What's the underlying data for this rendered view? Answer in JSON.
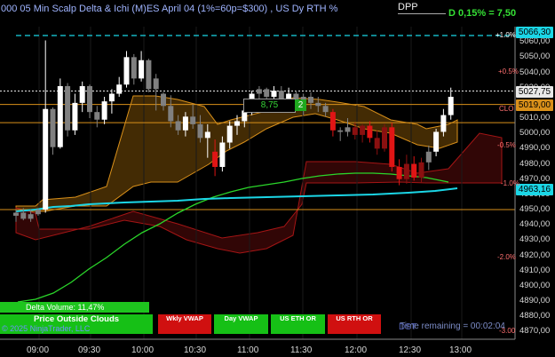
{
  "header": {
    "title": "000 05 Min Scalp Delta & Ichi (M)ES  April 04 (1%=60p=$300) , US Dy RTH %",
    "dpp_label": "DPP",
    "delta_readout": "D 0,15% = 7,50"
  },
  "price_axis": {
    "ticks": [
      "5060,00",
      "5050,00",
      "5040,00",
      "5030,00",
      "5010,00",
      "5000,00",
      "4990,00",
      "4980,00",
      "4970,00",
      "4960,00",
      "4950,00",
      "4940,00",
      "4930,00",
      "4920,00",
      "4910,00",
      "4900,00",
      "4890,00",
      "4880,00",
      "4870,00"
    ],
    "markers": [
      {
        "label": "5066,30",
        "color": "#1bd6e6",
        "text_color": "#000"
      },
      {
        "label": "5027,75",
        "color": "#e8e8e8",
        "text_color": "#000"
      },
      {
        "label": "5019,00",
        "color": "#d9901a",
        "text_color": "#000"
      },
      {
        "label": "4963,16",
        "color": "#1bd6e6",
        "text_color": "#000"
      }
    ]
  },
  "percent_labels": [
    "+1.0%",
    "+0.5%",
    "CLO",
    "-0.5%",
    "-1.0%",
    "-2.0%",
    "-3.00"
  ],
  "time_axis": {
    "ticks": [
      "09:00",
      "09:30",
      "10:00",
      "10:30",
      "11:00",
      "11:30",
      "12:00",
      "12:30",
      "13:00"
    ]
  },
  "price_marker": {
    "value": "8,75",
    "count": "2"
  },
  "delta_volume": {
    "label": "Delta Volume: 11,47%"
  },
  "status_buttons": [
    {
      "label": "Price Outside Clouds",
      "color": "#16c016"
    },
    {
      "label": "Wkly VWAP",
      "color": "#d01010"
    },
    {
      "label": "Day VWAP",
      "color": "#16c016"
    },
    {
      "label": "US ETH OR",
      "color": "#16c016"
    },
    {
      "label": "US RTH OR",
      "color": "#d01010"
    }
  ],
  "footer": {
    "copyright": "© 2025 NinjaTrader, LLC",
    "time_remaining": "Time remaining = 00:02:04",
    "dst": "DST"
  },
  "colors": {
    "background": "#000000",
    "bull_candle": "#ffffff",
    "bear_candle": "#d01010",
    "vwap": "#1bd6e6",
    "ema": "#2ad62a",
    "level_orange": "#d9901a"
  },
  "chart_data": {
    "type": "candlestick",
    "instrument": "ES April 04",
    "interval": "5 Min",
    "ylim": [
      4865,
      5070
    ],
    "candles": [
      {
        "o": 4946,
        "h": 4950,
        "l": 4942,
        "c": 4948,
        "col": "gray"
      },
      {
        "o": 4948,
        "h": 4951,
        "l": 4943,
        "c": 4944,
        "col": "gray"
      },
      {
        "o": 4944,
        "h": 4950,
        "l": 4942,
        "c": 4947,
        "col": "gray"
      },
      {
        "o": 4947,
        "h": 4951,
        "l": 4946,
        "c": 4950,
        "col": "gray"
      },
      {
        "o": 4950,
        "h": 5061,
        "l": 4948,
        "c": 5016,
        "col": "white"
      },
      {
        "o": 5016,
        "h": 5017,
        "l": 4986,
        "c": 4991,
        "col": "gray"
      },
      {
        "o": 4991,
        "h": 5036,
        "l": 4990,
        "c": 5031,
        "col": "white"
      },
      {
        "o": 5031,
        "h": 5033,
        "l": 4998,
        "c": 5002,
        "col": "gray"
      },
      {
        "o": 5002,
        "h": 5026,
        "l": 4999,
        "c": 5020,
        "col": "white"
      },
      {
        "o": 5020,
        "h": 5034,
        "l": 5014,
        "c": 5031,
        "col": "white"
      },
      {
        "o": 5031,
        "h": 5032,
        "l": 5010,
        "c": 5014,
        "col": "gray"
      },
      {
        "o": 5014,
        "h": 5018,
        "l": 5004,
        "c": 5009,
        "col": "gray"
      },
      {
        "o": 5009,
        "h": 5024,
        "l": 5006,
        "c": 5021,
        "col": "white"
      },
      {
        "o": 5021,
        "h": 5029,
        "l": 5013,
        "c": 5026,
        "col": "white"
      },
      {
        "o": 5026,
        "h": 5037,
        "l": 5024,
        "c": 5032,
        "col": "white"
      },
      {
        "o": 5032,
        "h": 5054,
        "l": 5030,
        "c": 5050,
        "col": "white"
      },
      {
        "o": 5050,
        "h": 5052,
        "l": 5032,
        "c": 5036,
        "col": "gray"
      },
      {
        "o": 5036,
        "h": 5054,
        "l": 5034,
        "c": 5048,
        "col": "white"
      },
      {
        "o": 5048,
        "h": 5049,
        "l": 5027,
        "c": 5029,
        "col": "gray"
      },
      {
        "o": 5029,
        "h": 5039,
        "l": 5015,
        "c": 5036,
        "col": "gray"
      },
      {
        "o": 5026,
        "h": 5027,
        "l": 5015,
        "c": 5018,
        "col": "gray"
      },
      {
        "o": 5018,
        "h": 5025,
        "l": 5004,
        "c": 5008,
        "col": "gray"
      },
      {
        "o": 5008,
        "h": 5012,
        "l": 4999,
        "c": 5002,
        "col": "gray"
      },
      {
        "o": 5002,
        "h": 5014,
        "l": 4998,
        "c": 5011,
        "col": "white"
      },
      {
        "o": 5011,
        "h": 5019,
        "l": 5003,
        "c": 5006,
        "col": "gray"
      },
      {
        "o": 5006,
        "h": 5012,
        "l": 4994,
        "c": 4997,
        "col": "gray"
      },
      {
        "o": 4997,
        "h": 5006,
        "l": 4984,
        "c": 5001,
        "col": "white"
      },
      {
        "o": 4988,
        "h": 4996,
        "l": 4972,
        "c": 4978,
        "col": "red"
      },
      {
        "o": 4978,
        "h": 4998,
        "l": 4975,
        "c": 4994,
        "col": "white"
      },
      {
        "o": 4994,
        "h": 5008,
        "l": 4990,
        "c": 5005,
        "col": "white"
      },
      {
        "o": 5005,
        "h": 5012,
        "l": 4999,
        "c": 5008,
        "col": "white"
      },
      {
        "o": 5008,
        "h": 5018,
        "l": 5004,
        "c": 5015,
        "col": "white"
      },
      {
        "o": 5015,
        "h": 5028,
        "l": 5012,
        "c": 5026,
        "col": "white"
      },
      {
        "o": 5026,
        "h": 5031,
        "l": 5020,
        "c": 5029,
        "col": "gray"
      },
      {
        "o": 5029,
        "h": 5030,
        "l": 5020,
        "c": 5024,
        "col": "gray"
      },
      {
        "o": 5024,
        "h": 5031,
        "l": 5020,
        "c": 5028,
        "col": "white"
      },
      {
        "o": 5028,
        "h": 5031,
        "l": 5019,
        "c": 5022,
        "col": "gray"
      },
      {
        "o": 5022,
        "h": 5030,
        "l": 5016,
        "c": 5026,
        "col": "white"
      },
      {
        "o": 5026,
        "h": 5028,
        "l": 5016,
        "c": 5019,
        "col": "gray"
      },
      {
        "o": 5019,
        "h": 5026,
        "l": 5012,
        "c": 5024,
        "col": "gray"
      },
      {
        "o": 5024,
        "h": 5027,
        "l": 5016,
        "c": 5020,
        "col": "gray"
      },
      {
        "o": 5020,
        "h": 5024,
        "l": 5014,
        "c": 5018,
        "col": "gray"
      },
      {
        "o": 5018,
        "h": 5020,
        "l": 5011,
        "c": 5014,
        "col": "gray"
      },
      {
        "o": 5014,
        "h": 5016,
        "l": 4998,
        "c": 5002,
        "col": "red"
      },
      {
        "o": 5002,
        "h": 5004,
        "l": 4995,
        "c": 5001,
        "col": "gray"
      },
      {
        "o": 5001,
        "h": 5010,
        "l": 4998,
        "c": 5004,
        "col": "gray"
      },
      {
        "o": 5004,
        "h": 5007,
        "l": 4996,
        "c": 4999,
        "col": "darkred"
      },
      {
        "o": 4999,
        "h": 5006,
        "l": 4994,
        "c": 5005,
        "col": "darkred"
      },
      {
        "o": 5005,
        "h": 5008,
        "l": 4994,
        "c": 4997,
        "col": "red"
      },
      {
        "o": 4997,
        "h": 5002,
        "l": 4986,
        "c": 4990,
        "col": "darkred"
      },
      {
        "o": 4990,
        "h": 5006,
        "l": 4988,
        "c": 5004,
        "col": "darkred"
      },
      {
        "o": 5004,
        "h": 5007,
        "l": 4975,
        "c": 4978,
        "col": "red"
      },
      {
        "o": 4978,
        "h": 4983,
        "l": 4966,
        "c": 4970,
        "col": "red"
      },
      {
        "o": 4970,
        "h": 4986,
        "l": 4967,
        "c": 4980,
        "col": "darkred"
      },
      {
        "o": 4980,
        "h": 4985,
        "l": 4969,
        "c": 4971,
        "col": "red"
      },
      {
        "o": 4971,
        "h": 4984,
        "l": 4968,
        "c": 4981,
        "col": "darkred"
      },
      {
        "o": 4981,
        "h": 4992,
        "l": 4976,
        "c": 4988,
        "col": "gray"
      },
      {
        "o": 4988,
        "h": 5003,
        "l": 4985,
        "c": 5001,
        "col": "white"
      },
      {
        "o": 5001,
        "h": 5016,
        "l": 4998,
        "c": 5012,
        "col": "white"
      },
      {
        "o": 5012,
        "h": 5030,
        "l": 5009,
        "c": 5024,
        "col": "white"
      }
    ],
    "levels": [
      {
        "name": "vwap-line",
        "value": 5066.3
      },
      {
        "name": "last-price-line",
        "value": 5027.75
      },
      {
        "name": "level-5019",
        "value": 5019.0
      },
      {
        "name": "level-5007",
        "value": 5007.0
      },
      {
        "name": "level-4950",
        "value": 4950.0
      }
    ]
  }
}
